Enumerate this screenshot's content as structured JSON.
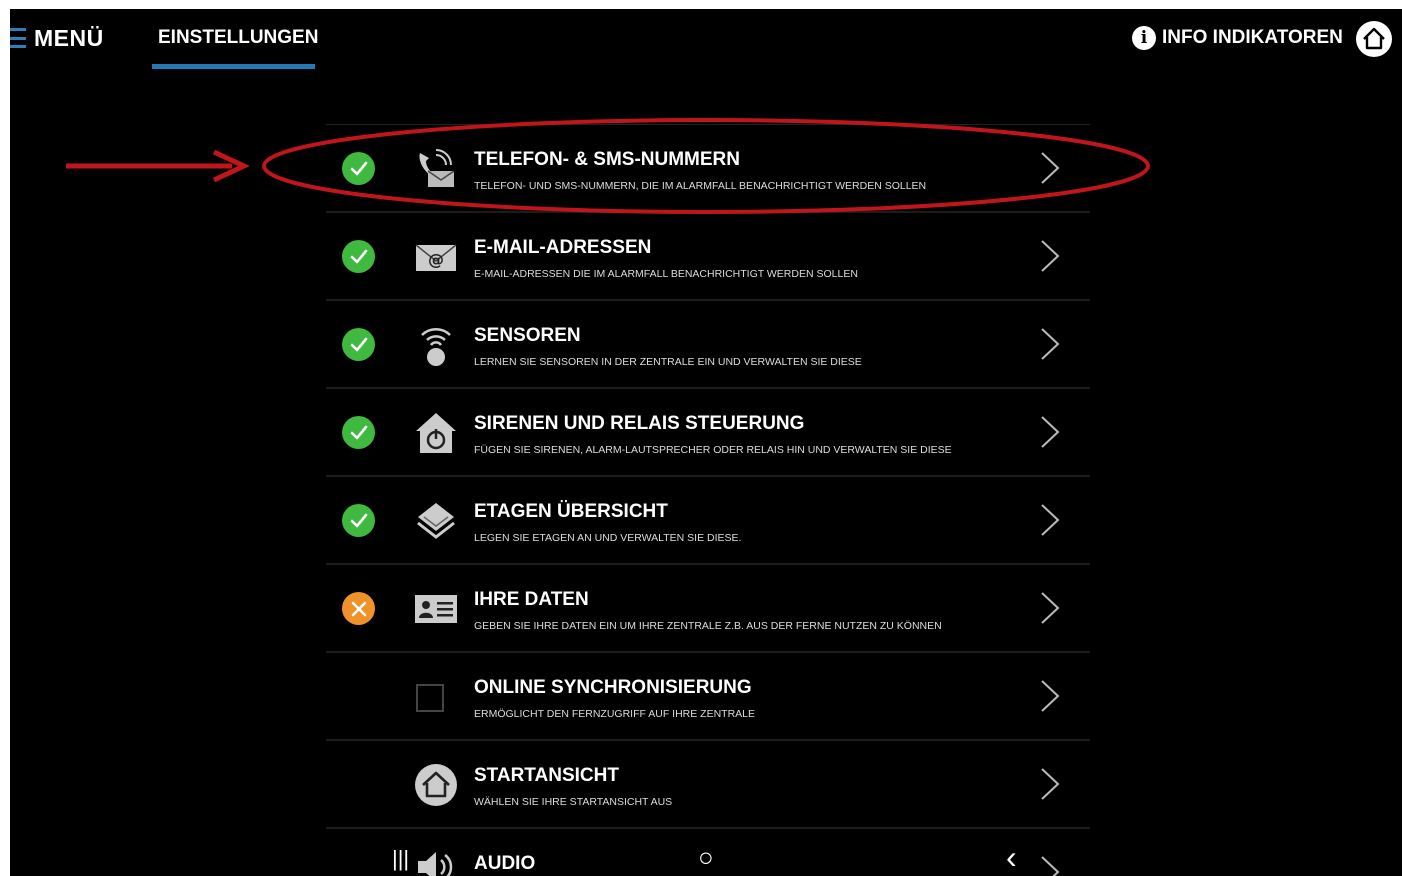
{
  "header": {
    "menu_label": "MENÜ",
    "tab_label": "EINSTELLUNGEN",
    "info_label": "INFO INDIKATOREN"
  },
  "colors": {
    "ok": "#3fb93f",
    "warn": "#f0922a",
    "accent": "#2478b4",
    "annotation": "#c0151b"
  },
  "settings": [
    {
      "status": "ok",
      "icon": "phone-sms-icon",
      "title": "TELEFON- & SMS-NUMMERN",
      "subtitle": "TELEFON- UND SMS-NUMMERN, DIE IM ALARMFALL BENACHRICHTIGT WERDEN SOLLEN"
    },
    {
      "status": "ok",
      "icon": "email-icon",
      "title": "E-MAIL-ADRESSEN",
      "subtitle": "E-MAIL-ADRESSEN DIE IM ALARMFALL BENACHRICHTIGT WERDEN SOLLEN"
    },
    {
      "status": "ok",
      "icon": "sensor-icon",
      "title": "SENSOREN",
      "subtitle": "LERNEN SIE SENSOREN IN DER ZENTRALE EIN UND VERWALTEN SIE DIESE"
    },
    {
      "status": "ok",
      "icon": "siren-power-icon",
      "title": "SIRENEN UND RELAIS STEUERUNG",
      "subtitle": "FÜGEN SIE SIRENEN, ALARM-LAUTSPRECHER ODER RELAIS HIN UND VERWALTEN SIE DIESE"
    },
    {
      "status": "ok",
      "icon": "floors-icon",
      "title": "ETAGEN ÜBERSICHT",
      "subtitle": "LEGEN SIE ETAGEN AN UND VERWALTEN SIE DIESE."
    },
    {
      "status": "warn",
      "icon": "id-card-icon",
      "title": "IHRE DATEN",
      "subtitle": "GEBEN SIE IHRE DATEN EIN UM IHRE ZENTRALE Z.B. AUS DER FERNE NUTZEN ZU KÖNNEN"
    },
    {
      "status": "unchecked",
      "icon": "",
      "title": "ONLINE SYNCHRONISIERUNG",
      "subtitle": "ERMÖGLICHT DEN FERNZUGRIFF AUF IHRE ZENTRALE"
    },
    {
      "status": "none",
      "icon": "home-icon",
      "title": "STARTANSICHT",
      "subtitle": "WÄHLEN SIE IHRE STARTANSICHT AUS"
    },
    {
      "status": "none",
      "icon": "audio-icon",
      "title": "AUDIO",
      "subtitle": ""
    }
  ],
  "android_nav": {
    "recents": "|||",
    "home": "○",
    "back": "‹"
  }
}
